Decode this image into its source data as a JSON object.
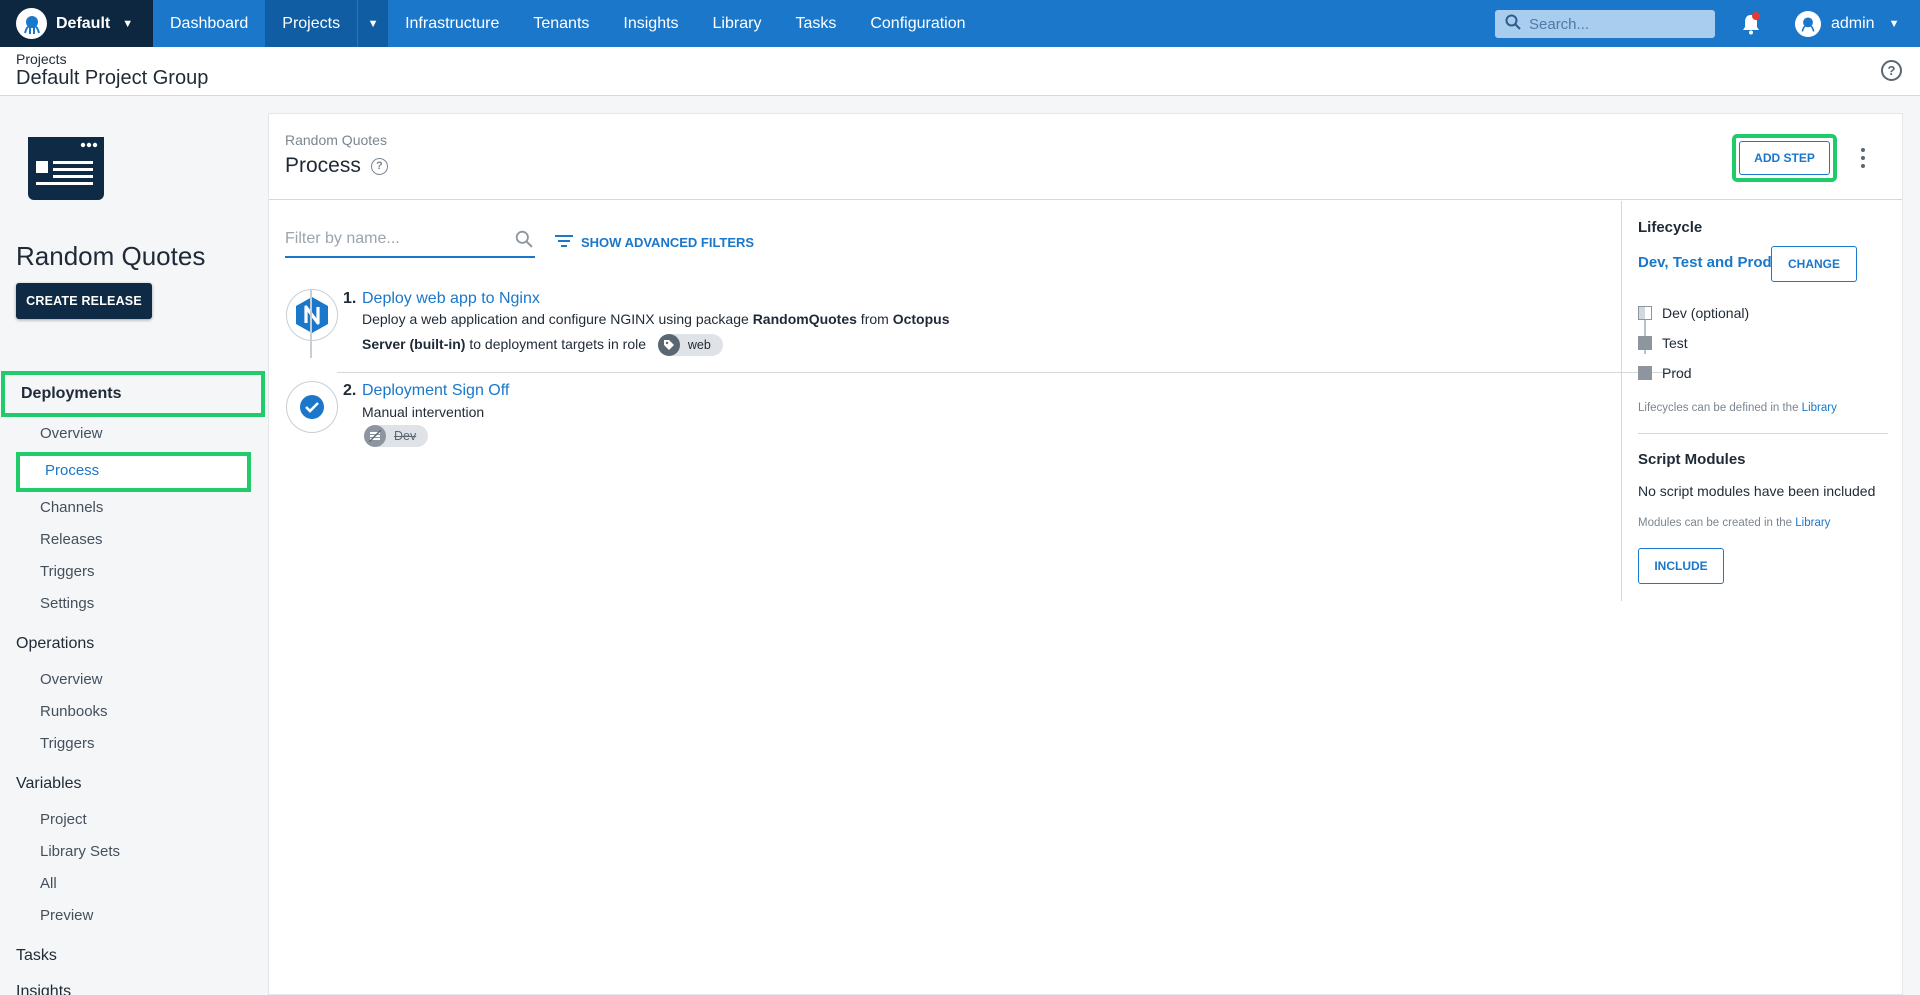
{
  "topnav": {
    "space": "Default",
    "items": [
      "Dashboard",
      "Projects",
      "Infrastructure",
      "Tenants",
      "Insights",
      "Library",
      "Tasks",
      "Configuration"
    ],
    "active": "Projects",
    "search_placeholder": "Search...",
    "user": "admin",
    "colors": {
      "bar": "#1a77ca",
      "space": "#0d2740",
      "notification": "#e53935"
    }
  },
  "header": {
    "breadcrumb": "Projects",
    "title": "Default Project Group"
  },
  "sidebar": {
    "project_name": "Random Quotes",
    "create_release": "CREATE RELEASE",
    "sections": [
      {
        "label": "Deployments",
        "items": [
          "Overview",
          "Process",
          "Channels",
          "Releases",
          "Triggers",
          "Settings"
        ]
      },
      {
        "label": "Operations",
        "items": [
          "Overview",
          "Runbooks",
          "Triggers"
        ]
      },
      {
        "label": "Variables",
        "items": [
          "Project",
          "Library Sets",
          "All",
          "Preview"
        ]
      },
      {
        "label": "Tasks",
        "items": []
      },
      {
        "label": "Insights",
        "items": []
      }
    ],
    "highlight_color": "#20cc6a"
  },
  "main": {
    "breadcrumb": "Random Quotes",
    "title": "Process",
    "add_step": "ADD STEP",
    "filter_placeholder": "Filter by name...",
    "advanced_filters": "SHOW ADVANCED FILTERS",
    "steps": [
      {
        "number": "1.",
        "title": "Deploy web app to Nginx",
        "desc_line1_a": "Deploy a web application and configure NGINX using package ",
        "desc_line1_b": "RandomQuotes",
        "desc_line1_c": " from ",
        "desc_line1_d": "Octopus",
        "desc_line2_a": "Server (built-in)",
        "desc_line2_b": " to deployment targets in role",
        "chip": "web",
        "icon": "nginx-icon"
      },
      {
        "number": "2.",
        "title": "Deployment Sign Off",
        "desc": "Manual intervention",
        "chip": "Dev",
        "icon": "check-circle-icon"
      }
    ]
  },
  "lifecycle": {
    "heading": "Lifecycle",
    "name": "Dev, Test and Prod",
    "change": "CHANGE",
    "phases": [
      "Dev (optional)",
      "Test",
      "Prod"
    ],
    "note_text": "Lifecycles can be defined in the ",
    "note_link": "Library"
  },
  "script_modules": {
    "heading": "Script Modules",
    "status": "No script modules have been included",
    "note_text": "Modules can be created in the ",
    "note_link": "Library",
    "include": "INCLUDE"
  }
}
